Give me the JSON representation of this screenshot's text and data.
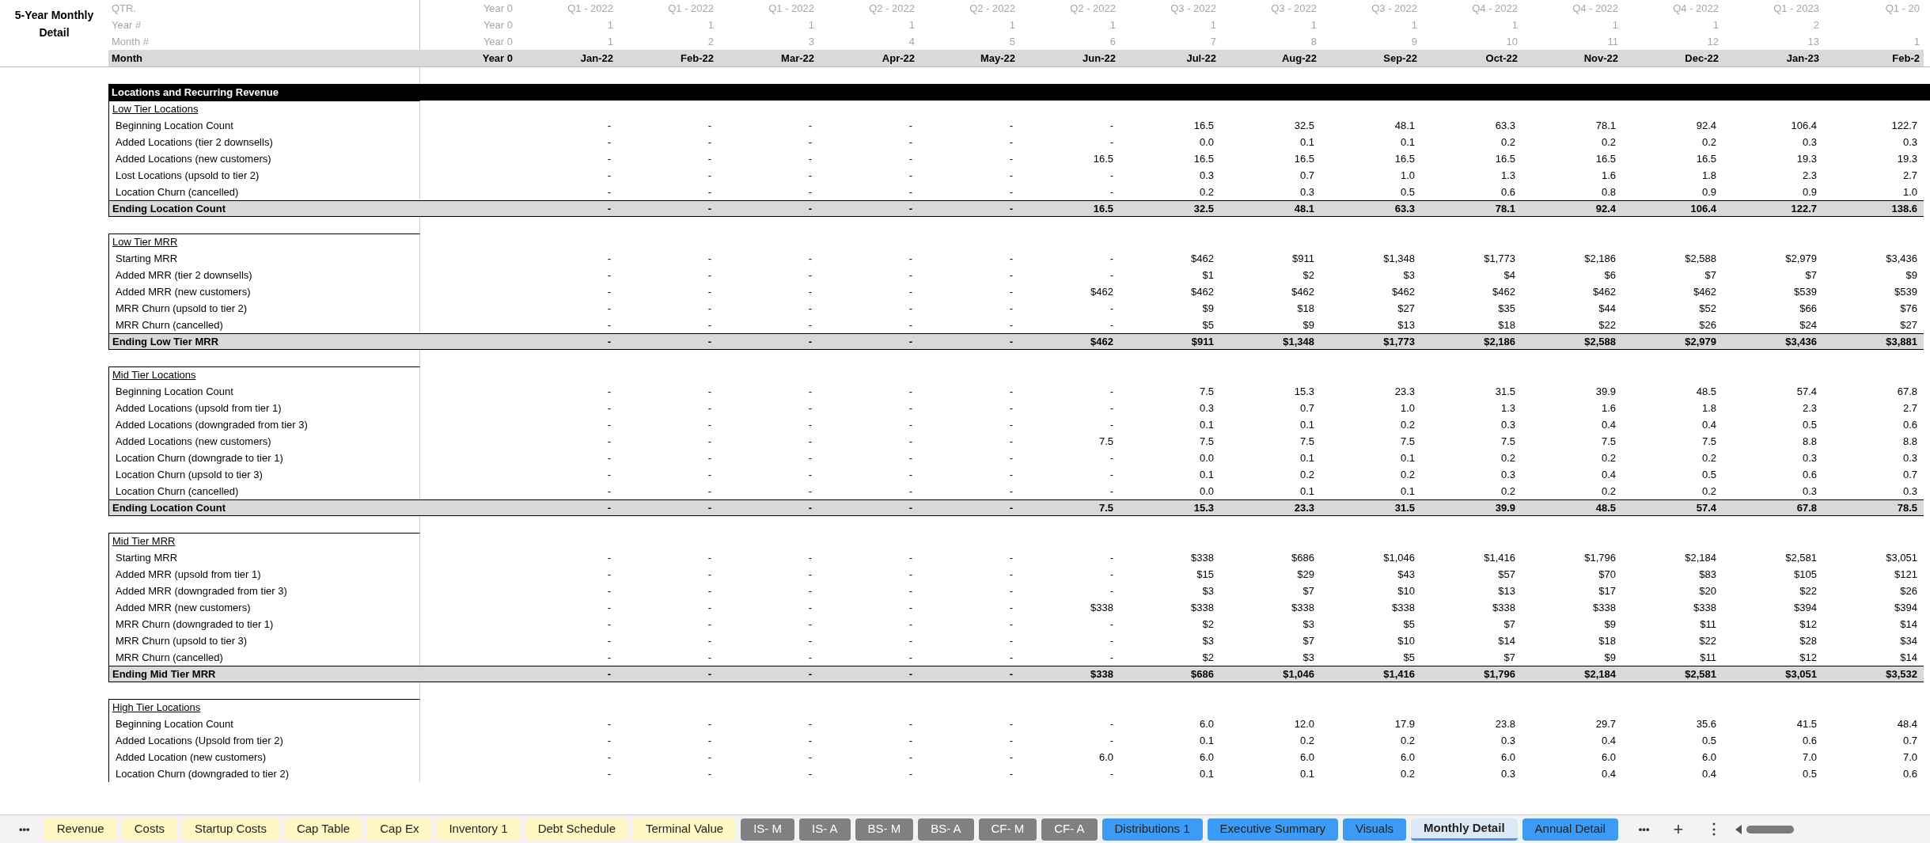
{
  "sheet_title": "5-Year Monthly Detail",
  "header_labels": [
    "QTR.",
    "Year #",
    "Month #",
    "Month"
  ],
  "columns": [
    {
      "qtr": "Year 0",
      "year": "Year 0",
      "month_num": "Year 0",
      "month": "Year 0"
    },
    {
      "qtr": "Q1 - 2022",
      "year": "1",
      "month_num": "1",
      "month": "Jan-22"
    },
    {
      "qtr": "Q1 - 2022",
      "year": "1",
      "month_num": "2",
      "month": "Feb-22"
    },
    {
      "qtr": "Q1 - 2022",
      "year": "1",
      "month_num": "3",
      "month": "Mar-22"
    },
    {
      "qtr": "Q2 - 2022",
      "year": "1",
      "month_num": "4",
      "month": "Apr-22"
    },
    {
      "qtr": "Q2 - 2022",
      "year": "1",
      "month_num": "5",
      "month": "May-22"
    },
    {
      "qtr": "Q2 - 2022",
      "year": "1",
      "month_num": "6",
      "month": "Jun-22"
    },
    {
      "qtr": "Q3 - 2022",
      "year": "1",
      "month_num": "7",
      "month": "Jul-22"
    },
    {
      "qtr": "Q3 - 2022",
      "year": "1",
      "month_num": "8",
      "month": "Aug-22"
    },
    {
      "qtr": "Q3 - 2022",
      "year": "1",
      "month_num": "9",
      "month": "Sep-22"
    },
    {
      "qtr": "Q4 - 2022",
      "year": "1",
      "month_num": "10",
      "month": "Oct-22"
    },
    {
      "qtr": "Q4 - 2022",
      "year": "1",
      "month_num": "11",
      "month": "Nov-22"
    },
    {
      "qtr": "Q4 - 2022",
      "year": "1",
      "month_num": "12",
      "month": "Dec-22"
    },
    {
      "qtr": "Q1 - 2023",
      "year": "2",
      "month_num": "13",
      "month": "Jan-23"
    },
    {
      "qtr": "Q1 - 20",
      "month_num": "1",
      "month": "Feb-2"
    }
  ],
  "banner": "Locations and Recurring Revenue",
  "sections": [
    {
      "title": "Low Tier Locations",
      "rows": [
        {
          "label": "Beginning Location Count",
          "kind": "line",
          "values": [
            "-",
            "-",
            "-",
            "-",
            "-",
            "-",
            "16.5",
            "32.5",
            "48.1",
            "63.3",
            "78.1",
            "92.4",
            "106.4",
            "122.7"
          ]
        },
        {
          "label": "Added Locations (tier 2 downsells)",
          "kind": "line",
          "values": [
            "-",
            "-",
            "-",
            "-",
            "-",
            "-",
            "0.0",
            "0.1",
            "0.1",
            "0.2",
            "0.2",
            "0.2",
            "0.3",
            "0.3"
          ]
        },
        {
          "label": "Added Locations (new customers)",
          "kind": "line",
          "values": [
            "-",
            "-",
            "-",
            "-",
            "-",
            "16.5",
            "16.5",
            "16.5",
            "16.5",
            "16.5",
            "16.5",
            "16.5",
            "19.3",
            "19.3"
          ]
        },
        {
          "label": "Lost Locations (upsold to tier 2)",
          "kind": "line",
          "values": [
            "-",
            "-",
            "-",
            "-",
            "-",
            "-",
            "0.3",
            "0.7",
            "1.0",
            "1.3",
            "1.6",
            "1.8",
            "2.3",
            "2.7"
          ]
        },
        {
          "label": "Location Churn (cancelled)",
          "kind": "line",
          "values": [
            "-",
            "-",
            "-",
            "-",
            "-",
            "-",
            "0.2",
            "0.3",
            "0.5",
            "0.6",
            "0.8",
            "0.9",
            "0.9",
            "1.0"
          ]
        },
        {
          "label": "Ending Location Count",
          "kind": "total",
          "values": [
            "-",
            "-",
            "-",
            "-",
            "-",
            "16.5",
            "32.5",
            "48.1",
            "63.3",
            "78.1",
            "92.4",
            "106.4",
            "122.7",
            "138.6"
          ]
        }
      ]
    },
    {
      "title": "Low Tier MRR",
      "rows": [
        {
          "label": "Starting MRR",
          "kind": "line",
          "values": [
            "-",
            "-",
            "-",
            "-",
            "-",
            "-",
            "$462",
            "$911",
            "$1,348",
            "$1,773",
            "$2,186",
            "$2,588",
            "$2,979",
            "$3,436"
          ]
        },
        {
          "label": "Added MRR (tier 2 downsells)",
          "kind": "line",
          "values": [
            "-",
            "-",
            "-",
            "-",
            "-",
            "-",
            "$1",
            "$2",
            "$3",
            "$4",
            "$6",
            "$7",
            "$7",
            "$9"
          ]
        },
        {
          "label": "Added MRR (new customers)",
          "kind": "line",
          "values": [
            "-",
            "-",
            "-",
            "-",
            "-",
            "$462",
            "$462",
            "$462",
            "$462",
            "$462",
            "$462",
            "$462",
            "$539",
            "$539"
          ]
        },
        {
          "label": "MRR Churn (upsold to tier 2)",
          "kind": "line",
          "values": [
            "-",
            "-",
            "-",
            "-",
            "-",
            "-",
            "$9",
            "$18",
            "$27",
            "$35",
            "$44",
            "$52",
            "$66",
            "$76"
          ]
        },
        {
          "label": "MRR Churn (cancelled)",
          "kind": "line",
          "values": [
            "-",
            "-",
            "-",
            "-",
            "-",
            "-",
            "$5",
            "$9",
            "$13",
            "$18",
            "$22",
            "$26",
            "$24",
            "$27"
          ]
        },
        {
          "label": "Ending Low Tier MRR",
          "kind": "total",
          "values": [
            "-",
            "-",
            "-",
            "-",
            "-",
            "$462",
            "$911",
            "$1,348",
            "$1,773",
            "$2,186",
            "$2,588",
            "$2,979",
            "$3,436",
            "$3,881"
          ]
        }
      ]
    },
    {
      "title": "Mid Tier Locations",
      "rows": [
        {
          "label": "Beginning Location Count",
          "kind": "line",
          "values": [
            "-",
            "-",
            "-",
            "-",
            "-",
            "-",
            "7.5",
            "15.3",
            "23.3",
            "31.5",
            "39.9",
            "48.5",
            "57.4",
            "67.8"
          ]
        },
        {
          "label": "Added Locations (upsold from tier 1)",
          "kind": "line",
          "values": [
            "-",
            "-",
            "-",
            "-",
            "-",
            "-",
            "0.3",
            "0.7",
            "1.0",
            "1.3",
            "1.6",
            "1.8",
            "2.3",
            "2.7"
          ]
        },
        {
          "label": "Added Locations (downgraded from tier 3)",
          "kind": "line",
          "values": [
            "-",
            "-",
            "-",
            "-",
            "-",
            "-",
            "0.1",
            "0.1",
            "0.2",
            "0.3",
            "0.4",
            "0.4",
            "0.5",
            "0.6"
          ]
        },
        {
          "label": "Added Locations (new customers)",
          "kind": "line",
          "values": [
            "-",
            "-",
            "-",
            "-",
            "-",
            "7.5",
            "7.5",
            "7.5",
            "7.5",
            "7.5",
            "7.5",
            "7.5",
            "8.8",
            "8.8"
          ]
        },
        {
          "label": "Location Churn (downgrade to tier 1)",
          "kind": "line",
          "values": [
            "-",
            "-",
            "-",
            "-",
            "-",
            "-",
            "0.0",
            "0.1",
            "0.1",
            "0.2",
            "0.2",
            "0.2",
            "0.3",
            "0.3"
          ]
        },
        {
          "label": "Location Churn (upsold to tier 3)",
          "kind": "line",
          "values": [
            "-",
            "-",
            "-",
            "-",
            "-",
            "-",
            "0.1",
            "0.2",
            "0.2",
            "0.3",
            "0.4",
            "0.5",
            "0.6",
            "0.7"
          ]
        },
        {
          "label": "Location Churn (cancelled)",
          "kind": "line",
          "values": [
            "-",
            "-",
            "-",
            "-",
            "-",
            "-",
            "0.0",
            "0.1",
            "0.1",
            "0.2",
            "0.2",
            "0.2",
            "0.3",
            "0.3"
          ]
        },
        {
          "label": "Ending Location Count",
          "kind": "total",
          "values": [
            "-",
            "-",
            "-",
            "-",
            "-",
            "7.5",
            "15.3",
            "23.3",
            "31.5",
            "39.9",
            "48.5",
            "57.4",
            "67.8",
            "78.5"
          ]
        }
      ]
    },
    {
      "title": "Mid Tier MRR",
      "rows": [
        {
          "label": "Starting MRR",
          "kind": "line",
          "values": [
            "-",
            "-",
            "-",
            "-",
            "-",
            "-",
            "$338",
            "$686",
            "$1,046",
            "$1,416",
            "$1,796",
            "$2,184",
            "$2,581",
            "$3,051"
          ]
        },
        {
          "label": "Added MRR (upsold from tier 1)",
          "kind": "line",
          "values": [
            "-",
            "-",
            "-",
            "-",
            "-",
            "-",
            "$15",
            "$29",
            "$43",
            "$57",
            "$70",
            "$83",
            "$105",
            "$121"
          ]
        },
        {
          "label": "Added MRR (downgraded from tier 3)",
          "kind": "line",
          "values": [
            "-",
            "-",
            "-",
            "-",
            "-",
            "-",
            "$3",
            "$7",
            "$10",
            "$13",
            "$17",
            "$20",
            "$22",
            "$26"
          ]
        },
        {
          "label": "Added MRR (new customers)",
          "kind": "line",
          "values": [
            "-",
            "-",
            "-",
            "-",
            "-",
            "$338",
            "$338",
            "$338",
            "$338",
            "$338",
            "$338",
            "$338",
            "$394",
            "$394"
          ]
        },
        {
          "label": "MRR Churn (downgraded to tier 1)",
          "kind": "line",
          "values": [
            "-",
            "-",
            "-",
            "-",
            "-",
            "-",
            "$2",
            "$3",
            "$5",
            "$7",
            "$9",
            "$11",
            "$12",
            "$14"
          ]
        },
        {
          "label": "MRR Churn (upsold to tier 3)",
          "kind": "line",
          "values": [
            "-",
            "-",
            "-",
            "-",
            "-",
            "-",
            "$3",
            "$7",
            "$10",
            "$14",
            "$18",
            "$22",
            "$28",
            "$34"
          ]
        },
        {
          "label": "MRR Churn (cancelled)",
          "kind": "line",
          "values": [
            "-",
            "-",
            "-",
            "-",
            "-",
            "-",
            "$2",
            "$3",
            "$5",
            "$7",
            "$9",
            "$11",
            "$12",
            "$14"
          ]
        },
        {
          "label": "Ending Mid Tier MRR",
          "kind": "total",
          "values": [
            "-",
            "-",
            "-",
            "-",
            "-",
            "$338",
            "$686",
            "$1,046",
            "$1,416",
            "$1,796",
            "$2,184",
            "$2,581",
            "$3,051",
            "$3,532"
          ]
        }
      ]
    },
    {
      "title": "High Tier Locations",
      "rows": [
        {
          "label": "Beginning Location Count",
          "kind": "line",
          "values": [
            "-",
            "-",
            "-",
            "-",
            "-",
            "-",
            "6.0",
            "12.0",
            "17.9",
            "23.8",
            "29.7",
            "35.6",
            "41.5",
            "48.4"
          ]
        },
        {
          "label": "Added Locations (Upsold from tier 2)",
          "kind": "line",
          "values": [
            "-",
            "-",
            "-",
            "-",
            "-",
            "-",
            "0.1",
            "0.2",
            "0.2",
            "0.3",
            "0.4",
            "0.5",
            "0.6",
            "0.7"
          ]
        },
        {
          "label": "Added Location (new customers)",
          "kind": "line",
          "values": [
            "-",
            "-",
            "-",
            "-",
            "-",
            "6.0",
            "6.0",
            "6.0",
            "6.0",
            "6.0",
            "6.0",
            "6.0",
            "7.0",
            "7.0"
          ]
        },
        {
          "label": "Location Churn (downgraded to tier 2)",
          "kind": "line",
          "values": [
            "-",
            "-",
            "-",
            "-",
            "-",
            "-",
            "0.1",
            "0.1",
            "0.2",
            "0.3",
            "0.4",
            "0.4",
            "0.5",
            "0.6"
          ]
        }
      ]
    }
  ],
  "tab_bar": {
    "more_left": "•••",
    "more_right": "•••",
    "add": "+",
    "options": "⋮"
  },
  "tabs": [
    {
      "label": "Revenue",
      "color": "#fff8c5",
      "selected": false
    },
    {
      "label": "Costs",
      "color": "#fff8c5",
      "selected": false
    },
    {
      "label": "Startup Costs",
      "color": "#fff8c5",
      "selected": false
    },
    {
      "label": "Cap Table",
      "color": "#fff8c5",
      "selected": false
    },
    {
      "label": "Cap Ex",
      "color": "#fff8c5",
      "selected": false
    },
    {
      "label": "Inventory 1",
      "color": "#fff8c5",
      "selected": false
    },
    {
      "label": "Debt Schedule",
      "color": "#fff8c5",
      "selected": false
    },
    {
      "label": "Terminal Value",
      "color": "#fff8c5",
      "selected": false
    },
    {
      "label": "IS- M",
      "color": "#808080",
      "selected": false
    },
    {
      "label": "IS- A",
      "color": "#808080",
      "selected": false
    },
    {
      "label": "BS- M",
      "color": "#808080",
      "selected": false
    },
    {
      "label": "BS- A",
      "color": "#808080",
      "selected": false
    },
    {
      "label": "CF- M",
      "color": "#808080",
      "selected": false
    },
    {
      "label": "CF- A",
      "color": "#808080",
      "selected": false
    },
    {
      "label": "Distributions 1",
      "color": "#3d9bf5",
      "selected": false
    },
    {
      "label": "Executive Summary",
      "color": "#3d9bf5",
      "selected": false
    },
    {
      "label": "Visuals",
      "color": "#3d9bf5",
      "selected": false
    },
    {
      "label": "Monthly Detail",
      "color": "#3d9bf5",
      "selected": true
    },
    {
      "label": "Annual Detail",
      "color": "#3d9bf5",
      "selected": false
    }
  ]
}
